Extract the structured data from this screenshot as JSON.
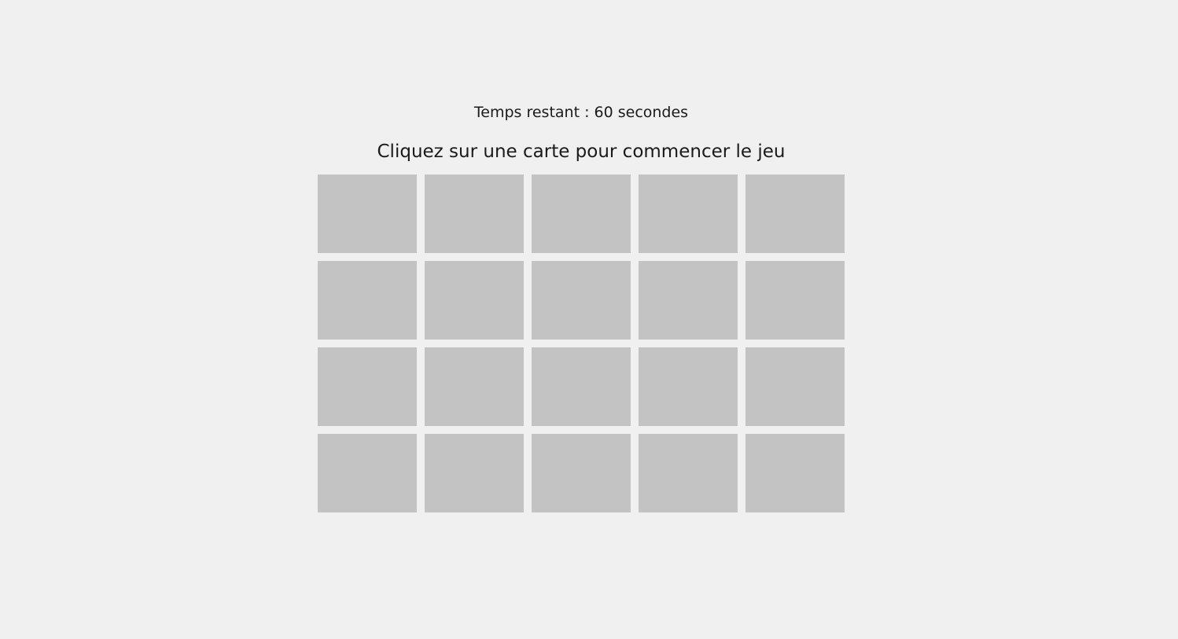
{
  "game": {
    "timer_text": "Temps restant : 60 secondes",
    "instruction": "Cliquez sur une carte pour commencer le jeu",
    "rows": 4,
    "columns": 5,
    "card_back_color": "#c3c3c3",
    "background_color": "#f0f0f0"
  }
}
